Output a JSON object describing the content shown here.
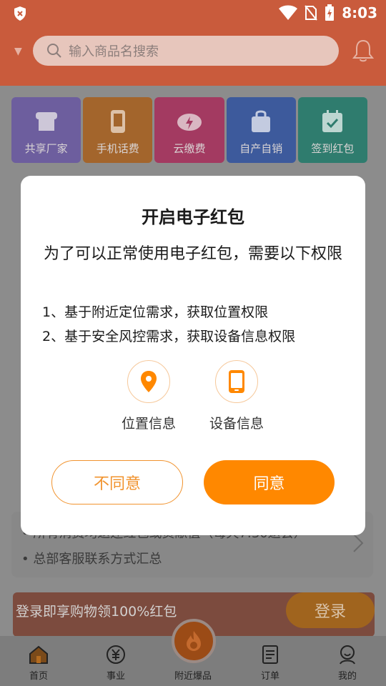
{
  "status_bar": {
    "time": "8:03"
  },
  "header": {
    "search_placeholder": "输入商品名搜索"
  },
  "categories": [
    {
      "label": "共享厂家",
      "color": "#6d5e9e"
    },
    {
      "label": "手机话费",
      "color": "#a3652c"
    },
    {
      "label": "云缴费",
      "color": "#a33a61"
    },
    {
      "label": "自产自销",
      "color": "#3d5a9c"
    },
    {
      "label": "签到红包",
      "color": "#2f7c6e"
    }
  ],
  "notice": {
    "line1": "• 所有消费均返还红包或贡献值（每天7:30返会）",
    "line2": "• 总部客服联系方式汇总"
  },
  "banner": {
    "text": "登录即享购物领100%红包",
    "login_label": "登录"
  },
  "tabbar": {
    "tabs": [
      "首页",
      "事业",
      "附近爆品",
      "订单",
      "我的"
    ]
  },
  "dialog": {
    "title": "开启电子红包",
    "subtitle": "为了可以正常使用电子红包，需要以下权限",
    "items": [
      "1、基于附近定位需求，获取位置权限",
      "2、基于安全风控需求，获取设备信息权限"
    ],
    "permissions": [
      "位置信息",
      "设备信息"
    ],
    "disagree_label": "不同意",
    "agree_label": "同意"
  },
  "colors": {
    "accent": "#ff8800",
    "header": "#c95b3c"
  }
}
